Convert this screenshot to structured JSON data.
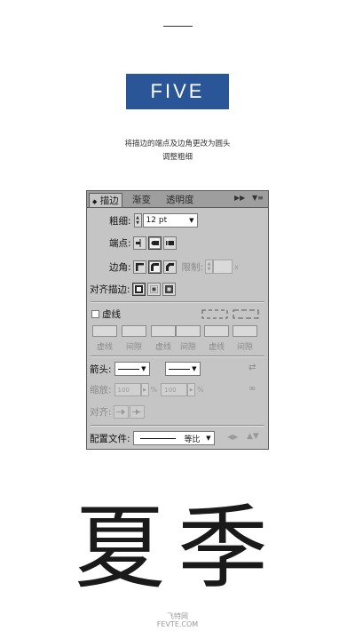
{
  "heading": "FIVE",
  "caption": {
    "line1": "将描边的端点及边角更改为圆头",
    "line2": "调整粗细"
  },
  "panel": {
    "tabs": [
      "描边",
      "渐变",
      "透明度"
    ],
    "weight": {
      "label": "粗细:",
      "value": "12 pt"
    },
    "cap": {
      "label": "端点:"
    },
    "corner": {
      "label": "边角:",
      "limit_label": "限制:",
      "limit_unit": "x"
    },
    "align": {
      "label": "对齐描边:"
    },
    "dashed": {
      "label": "虚线",
      "slot_labels": [
        "虚线",
        "间隙",
        "虚线",
        "间隙",
        "虚线",
        "间隙"
      ]
    },
    "arrows": {
      "label": "箭头:"
    },
    "scale": {
      "label": "缩放:",
      "value1": "100",
      "value2": "100",
      "unit": "%"
    },
    "arrow_align": {
      "label": "对齐:"
    },
    "profile": {
      "label": "配置文件:",
      "value": "等比"
    }
  },
  "big_text": "夏季",
  "watermark": {
    "line1": "飞特网",
    "line2": "FEVTE.COM"
  },
  "colors": {
    "banner": "#2a5597",
    "panel_bg": "#c5c5c5"
  }
}
